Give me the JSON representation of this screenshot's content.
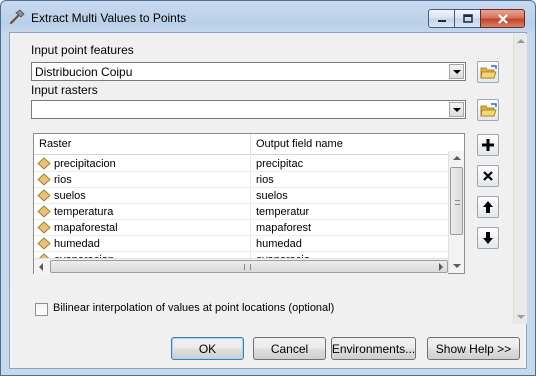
{
  "window": {
    "title": "Extract Multi Values to Points"
  },
  "form": {
    "input_point_label": "Input point features",
    "input_point_value": "Distribucion Coipu",
    "input_rasters_label": "Input rasters",
    "input_rasters_value": "",
    "table": {
      "columns": [
        "Raster",
        "Output field name"
      ],
      "rows": [
        {
          "raster": "precipitacion",
          "field": "precipitac"
        },
        {
          "raster": "rios",
          "field": "rios"
        },
        {
          "raster": "suelos",
          "field": "suelos"
        },
        {
          "raster": "temperatura",
          "field": "temperatur"
        },
        {
          "raster": "mapaforestal",
          "field": "mapaforest"
        },
        {
          "raster": "humedad",
          "field": "humedad"
        },
        {
          "raster": "evaporacion",
          "field": "evaporacio"
        }
      ]
    },
    "bilinear_label": "Bilinear interpolation of values at  point locations (optional)",
    "bilinear_checked": false
  },
  "buttons": {
    "ok": "OK",
    "cancel": "Cancel",
    "environments": "Environments...",
    "show_help": "Show Help >>"
  },
  "icons": {
    "title": "hammer-icon",
    "browse": "open-folder-icon",
    "add": "plus-icon",
    "remove": "x-icon",
    "up": "arrow-up-icon",
    "down": "arrow-down-icon",
    "raster": "raster-layer-icon"
  },
  "colors": {
    "titlebar": "#c9daef",
    "close_button": "#c2432a",
    "dialog_background": "#f0f0f0",
    "raster_icon": "#e6c27a"
  }
}
